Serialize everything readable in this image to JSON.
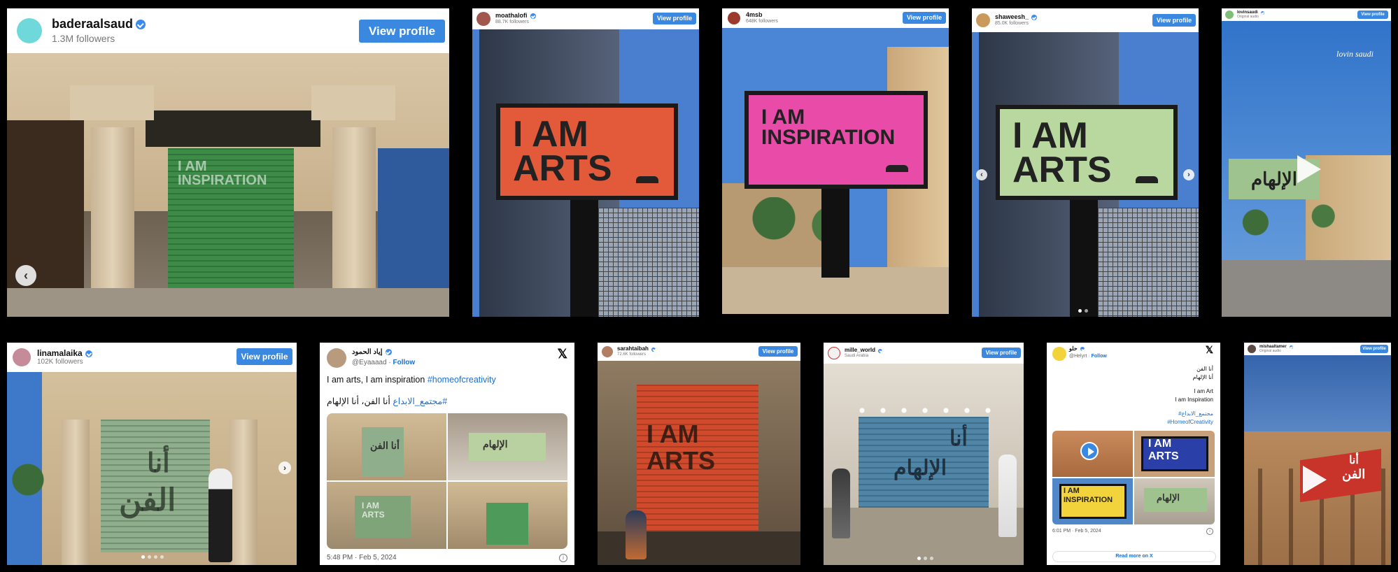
{
  "view_profile_label": "View profile",
  "colors": {
    "accent": "#3b88e0",
    "sign_orange": "#e35a3b",
    "sign_pink": "#e84ba8",
    "sign_green": "#b9d8a0",
    "link": "#1d6fd0"
  },
  "cards": {
    "c1": {
      "username": "baderaalsaud",
      "followers": "1.3M followers",
      "shutter_text": "I AM INSPIRATION"
    },
    "c2": {
      "username": "moathalofi",
      "followers": "88.7K followers",
      "sign_line1": "I AM",
      "sign_line2": "ARTS"
    },
    "c3": {
      "username": "4msb",
      "followers": "648K followers",
      "sign_line1": "I AM",
      "sign_line2": "INSPIRATION"
    },
    "c4": {
      "username": "shaweesh_",
      "followers": "85.0K followers",
      "sign_line1": "I AM",
      "sign_line2": "ARTS"
    },
    "c5": {
      "username": "lovinsaudi",
      "sub": "Original audio",
      "watermark": "lovin saudi",
      "sign_ar": "الإلهام"
    },
    "c6": {
      "username": "linamalaika",
      "followers": "102K followers",
      "shutter_ar1": "أنا",
      "shutter_ar2": "الفن"
    },
    "c7": {
      "name": "إياد الحمود",
      "handle": "@Eyaaaad",
      "follow": "Follow",
      "text_en": "I am arts, I am inspiration",
      "hashtag_en": "#homeofcreativity",
      "text_ar": "أنا الفن، أنا الإلهام",
      "hashtag_ar": "#مجتمع_الابداع",
      "tile_ar1": "أنا الفن",
      "tile_ar2": "الإلهام",
      "tile_en": "I AM ARTS",
      "timestamp": "5:48 PM · Feb 5, 2024"
    },
    "c8": {
      "username": "sarahtaibah",
      "followers": "72.6K followers",
      "shutter_line1": "I AM",
      "shutter_line2": "ARTS"
    },
    "c9": {
      "username": "mille_world",
      "location": "Saudi Arabia",
      "shutter_ar1": "أنا",
      "shutter_ar2": "الإلهام"
    },
    "c10": {
      "name": "حلو",
      "handle": "@Helyrt",
      "follow": "Follow",
      "ar1": "أنا الفن",
      "ar2": "أنا الإلهام",
      "en1": "I am Art",
      "en2": "I am Inspiration",
      "hashtag_ar": "#مجتمع_الابداع",
      "hashtag_en": "#HomeofCreativity",
      "tile1_l1": "I AM",
      "tile1_l2": "ARTS",
      "tile2_l1": "I AM",
      "tile2_l2": "INSPIRATION",
      "tile_ar": "الإلهام",
      "timestamp": "6:01 PM · Feb 5, 2024",
      "read_more": "Read more on X"
    },
    "c11": {
      "username": "mishaaltamer",
      "sub": "Original audio",
      "sign_ar1": "أنا",
      "sign_ar2": "الفن"
    }
  }
}
